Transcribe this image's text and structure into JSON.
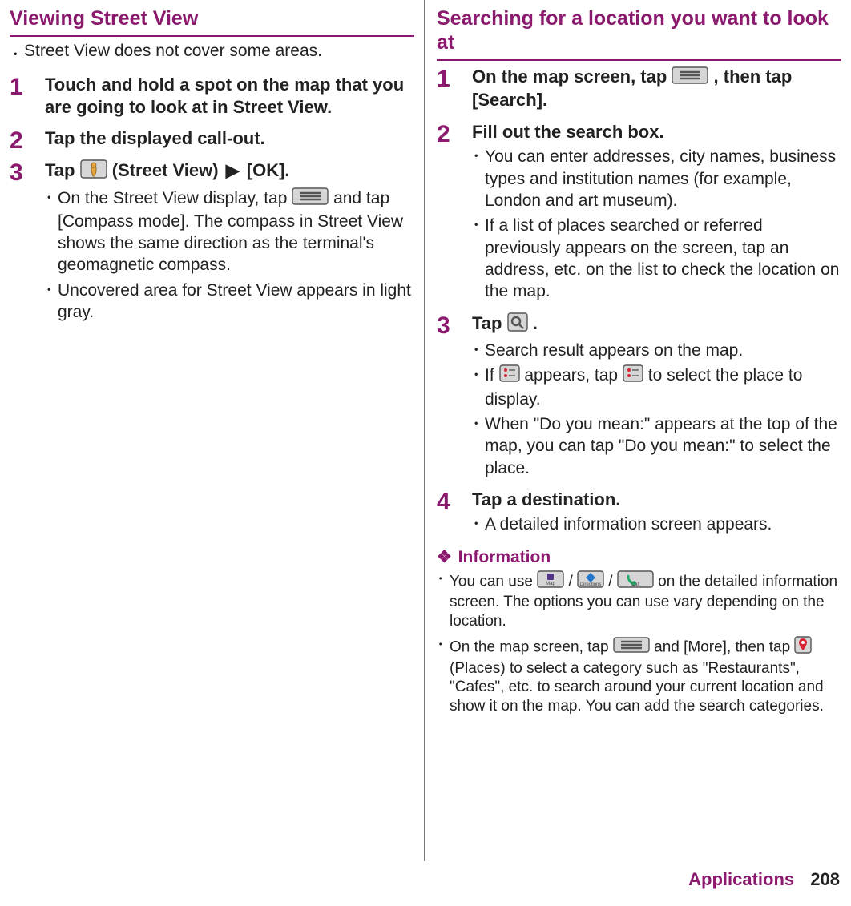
{
  "left": {
    "title": "Viewing Street View",
    "intro": "Street View does not cover some areas.",
    "step1_title": "Touch and hold a spot on the map that you are going to look at in Street View.",
    "step2_title": "Tap the displayed call-out.",
    "step3_title_a": "Tap ",
    "step3_title_b": " (Street View)",
    "step3_title_c": "[OK].",
    "step3_bul1_a": "On the Street View display, tap ",
    "step3_bul1_b": " and tap [Compass mode]. The compass in Street View shows the same direction as the terminal's geomagnetic compass.",
    "step3_bul2": "Uncovered area for Street View appears in light gray."
  },
  "right": {
    "title": "Searching for a location you want to look at",
    "step1_title_a": "On the map screen, tap ",
    "step1_title_b": ", then tap [Search].",
    "step2_title": "Fill out the search box.",
    "step2_bul1": "You can enter addresses, city names, business types and institution names (for example, London and art museum).",
    "step2_bul2": "If a list of places searched or referred previously appears on the screen, tap an address, etc. on the list to check the location on the map.",
    "step3_title_a": "Tap ",
    "step3_title_b": ".",
    "step3_bul1": "Search result appears on the map.",
    "step3_bul2_a": "If ",
    "step3_bul2_b": " appears, tap ",
    "step3_bul2_c": " to select the place to display.",
    "step3_bul3": "When \"Do you mean:\" appears at the top of the map, you can tap \"Do you mean:\" to select the place.",
    "step4_title": "Tap a destination.",
    "step4_bul1": "A detailed information screen appears.",
    "info_head": "Information",
    "info_bul1_a": "You can use ",
    "info_bul1_b": " / ",
    "info_bul1_c": " / ",
    "info_bul1_d": " on the detailed information screen. The options you can use vary depending on the location.",
    "info_bul2_a": "On the map screen, tap ",
    "info_bul2_b": " and [More], then tap ",
    "info_bul2_c": " (Places) to select a category such as \"Restaurants\", \"Cafes\", etc. to search around your current location and show it on the map. You can add the search categories."
  },
  "footer": {
    "section": "Applications",
    "page": "208"
  },
  "nums": {
    "n1": "1",
    "n2": "2",
    "n3": "3",
    "n4": "4"
  },
  "glyphs": {
    "bullet": "･",
    "triangle": "▶",
    "diamond": "❖"
  }
}
